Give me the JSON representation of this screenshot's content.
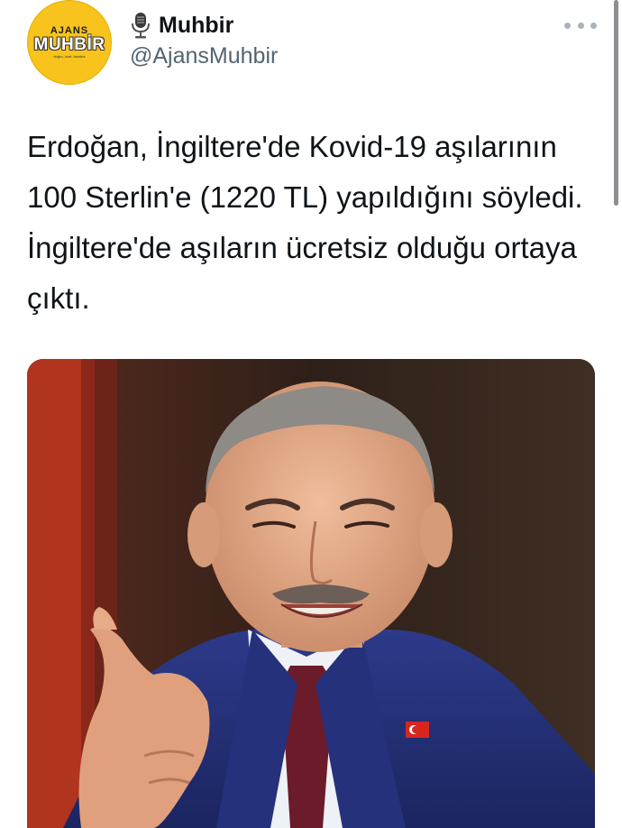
{
  "account": {
    "avatar_text": {
      "line1": "AJANS",
      "line2": "MUHBİR",
      "line3": "doğru, özet, tarafsız"
    },
    "display_name": "Muhbir",
    "handle": "@AjansMuhbir",
    "icons": {
      "name_emoji": "microphone-icon",
      "more": "more-options-icon"
    }
  },
  "tweet": {
    "text": "Erdoğan, İngiltere'de Kovid-19 aşılarının 100 Sterlin'e (1220 TL) yapıldığını söyledi. İngiltere'de aşıların ücretsiz olduğu ortaya çıktı."
  },
  "colors": {
    "avatar_bg": "#f7c31c",
    "text_primary": "#0f1419",
    "text_secondary": "#536471"
  }
}
